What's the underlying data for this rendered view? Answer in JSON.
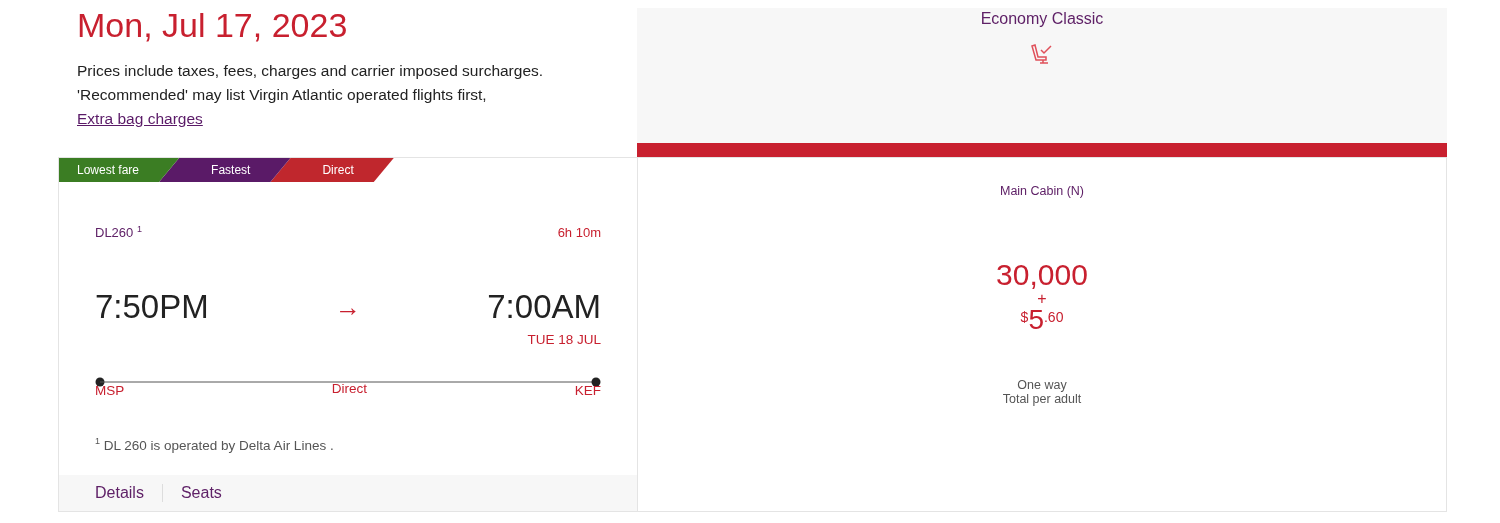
{
  "date": "Mon, Jul 17, 2023",
  "notice": {
    "text": "Prices include taxes, fees, charges and carrier imposed surcharges. 'Recommended' may list Virgin Atlantic operated flights first,",
    "link": " Extra bag charges"
  },
  "cabin_header": {
    "title": "Economy Classic"
  },
  "tags": [
    {
      "label": "Lowest fare",
      "color": "#3b7d23"
    },
    {
      "label": "Fastest",
      "color": "#5a1a67"
    },
    {
      "label": "Direct",
      "color": "#c0272d"
    }
  ],
  "flight": {
    "number": "DL260 $^{1}$",
    "duration": "6h 10m",
    "depart_time": "7:50PM",
    "arrow": "→",
    "arrive_time": "7:00AM",
    "arrive_date": "TUE 18 JUL",
    "origin": "MSP",
    "stops": "Direct",
    "destination": "KEF",
    "footnote": "$^{1}$ DL 260 is operated by Delta Air Lines ."
  },
  "links": [
    {
      "label": "Details"
    },
    {
      "label": "Seats"
    }
  ],
  "fare": {
    "cabin": "Main Cabin (N)",
    "points": "30,000",
    "plus": "+",
    "currency": "$",
    "amount": "5",
    "cents": ".60",
    "trip": "One way",
    "basis": "Total per adult"
  }
}
